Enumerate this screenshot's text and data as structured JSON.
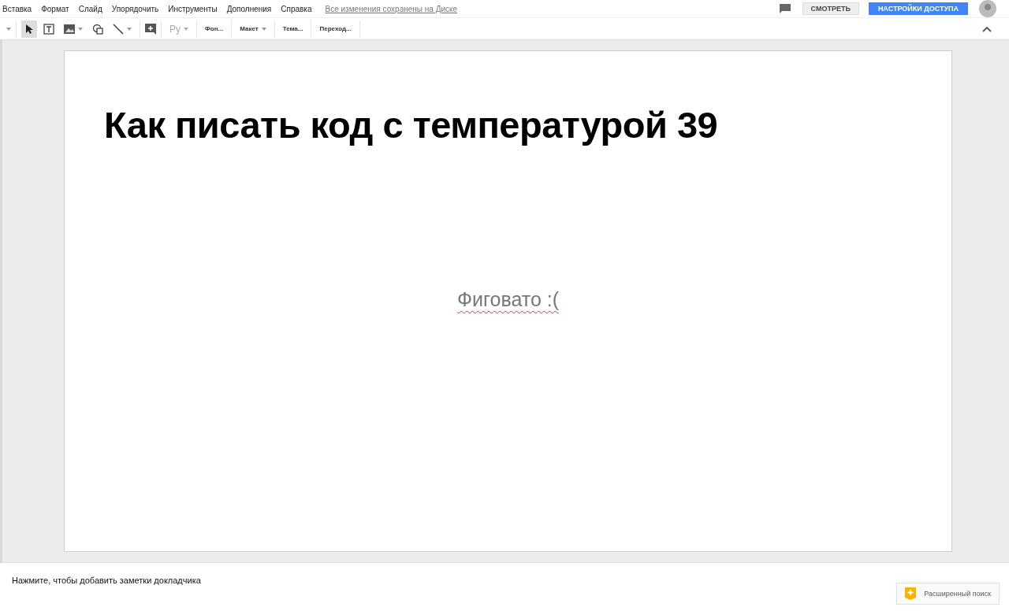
{
  "menu": [
    "Вставка",
    "Формат",
    "Слайд",
    "Упорядочить",
    "Инструменты",
    "Дополнения",
    "Справка"
  ],
  "save_status": "Все изменения сохранены на Диске",
  "header_buttons": {
    "present": "СМОТРЕТЬ",
    "share": "НАСТРОЙКИ ДОСТУПА"
  },
  "toolbar": {
    "tools": [
      {
        "selected": true
      },
      {
        "selected": false
      },
      {
        "selected": false
      },
      {
        "selected": false
      },
      {
        "selected": false
      }
    ],
    "input_tool": {
      "label": "Ру",
      "disabled": true
    },
    "buttons": [
      {
        "label": "Фон...",
        "dropdown": false
      },
      {
        "label": "Макет",
        "dropdown": true
      },
      {
        "label": "Тема...",
        "dropdown": false
      },
      {
        "label": "Переход...",
        "dropdown": false
      }
    ]
  },
  "slide": {
    "title": "Как писать код с температурой 39",
    "subtitle": "Фиговато :(",
    "subtitle_misspelled": true
  },
  "notes": {
    "placeholder": "Нажмите, чтобы добавить заметки докладчика"
  },
  "explore_button": "Расширенный поиск"
}
